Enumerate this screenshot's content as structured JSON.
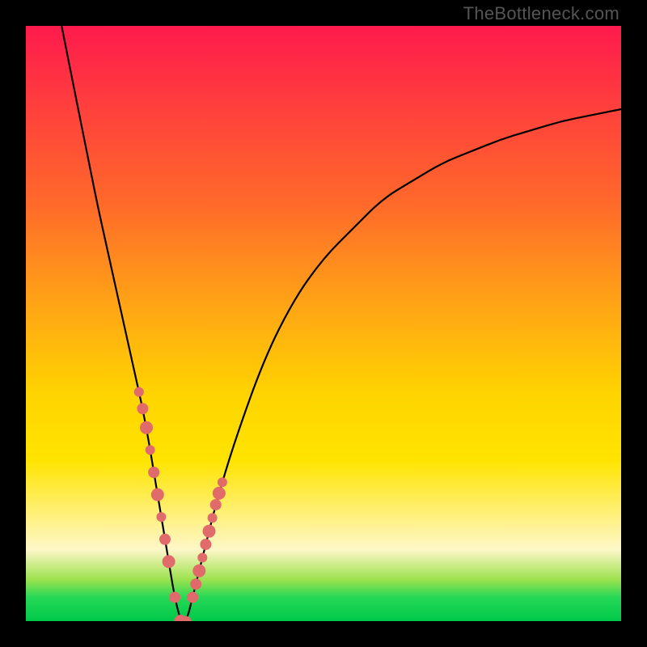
{
  "watermark": "TheBottleneck.com",
  "chart_data": {
    "type": "line",
    "title": "",
    "xlabel": "",
    "ylabel": "",
    "xlim": [
      0,
      100
    ],
    "ylim": [
      0,
      100
    ],
    "grid": false,
    "series": [
      {
        "name": "bottleneck-curve",
        "x": [
          6,
          8,
          10,
          12,
          14,
          16,
          18,
          20,
          22,
          24,
          25,
          26,
          27,
          28,
          30,
          32,
          35,
          40,
          45,
          50,
          55,
          60,
          65,
          70,
          75,
          80,
          85,
          90,
          95,
          100
        ],
        "y": [
          100,
          90,
          80,
          70,
          61,
          52,
          43,
          34,
          22,
          10,
          4,
          0,
          0,
          4,
          12,
          20,
          30,
          44,
          54,
          61,
          66,
          71,
          74,
          77,
          79,
          81,
          82.5,
          84,
          85,
          86
        ]
      }
    ],
    "markers": [
      {
        "name": "left-cluster",
        "xrange": [
          19,
          24
        ],
        "yrange": [
          10,
          34
        ],
        "count": 9
      },
      {
        "name": "right-cluster",
        "xrange": [
          28,
          33
        ],
        "yrange": [
          4,
          28
        ],
        "count": 10
      },
      {
        "name": "valley-cluster",
        "xrange": [
          24,
          28
        ],
        "yrange": [
          0,
          6
        ],
        "count": 5
      }
    ],
    "marker_color": "#e16a6a",
    "gradient_stops": [
      {
        "pct": 0,
        "color": "#ff1a4d"
      },
      {
        "pct": 30,
        "color": "#ff6a2a"
      },
      {
        "pct": 62,
        "color": "#ffd400"
      },
      {
        "pct": 88,
        "color": "#fdf7c8"
      },
      {
        "pct": 96,
        "color": "#27d857"
      },
      {
        "pct": 100,
        "color": "#00c84a"
      }
    ]
  }
}
